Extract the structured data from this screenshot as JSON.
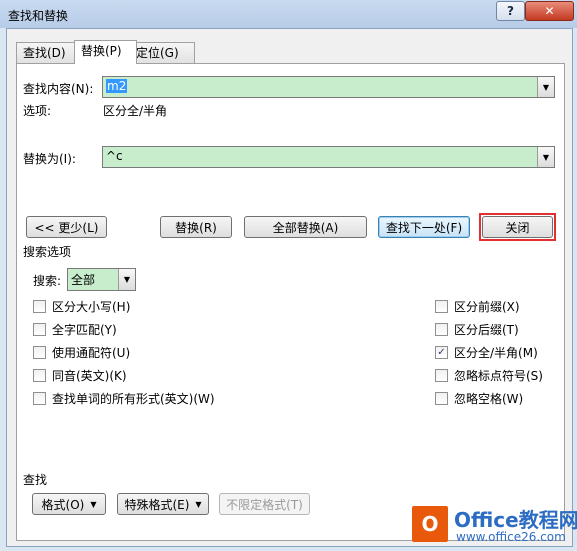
{
  "window": {
    "title": "查找和替换",
    "help": "?",
    "close": "✕"
  },
  "tabs": [
    {
      "label": "查找(D)"
    },
    {
      "label": "替换(P)"
    },
    {
      "label": "定位(G)"
    }
  ],
  "find": {
    "label": "查找内容(N):",
    "value": "m2"
  },
  "options": {
    "label": "选项:",
    "value": "区分全/半角"
  },
  "replace": {
    "label": "替换为(I):",
    "value": "^c"
  },
  "buttons": {
    "less": "<< 更少(L)",
    "replace": "替换(R)",
    "replace_all": "全部替换(A)",
    "find_next": "查找下一处(F)",
    "close": "关闭"
  },
  "search_options": {
    "title": "搜索选项",
    "search_label": "搜索:",
    "search_value": "全部",
    "left": [
      {
        "label": "区分大小写(H)",
        "checked": false
      },
      {
        "label": "全字匹配(Y)",
        "checked": false
      },
      {
        "label": "使用通配符(U)",
        "checked": false
      },
      {
        "label": "同音(英文)(K)",
        "checked": false
      },
      {
        "label": "查找单词的所有形式(英文)(W)",
        "checked": false
      }
    ],
    "right": [
      {
        "label": "区分前缀(X)",
        "checked": false
      },
      {
        "label": "区分后缀(T)",
        "checked": false
      },
      {
        "label": "区分全/半角(M)",
        "checked": true
      },
      {
        "label": "忽略标点符号(S)",
        "checked": false
      },
      {
        "label": "忽略空格(W)",
        "checked": false
      }
    ]
  },
  "find_section": {
    "title": "查找",
    "format": "格式(O)",
    "special": "特殊格式(E)",
    "no_format": "不限定格式(T)"
  },
  "watermark": {
    "logo": "O",
    "line1": "Office教程网",
    "line2": "www.office26.com"
  }
}
